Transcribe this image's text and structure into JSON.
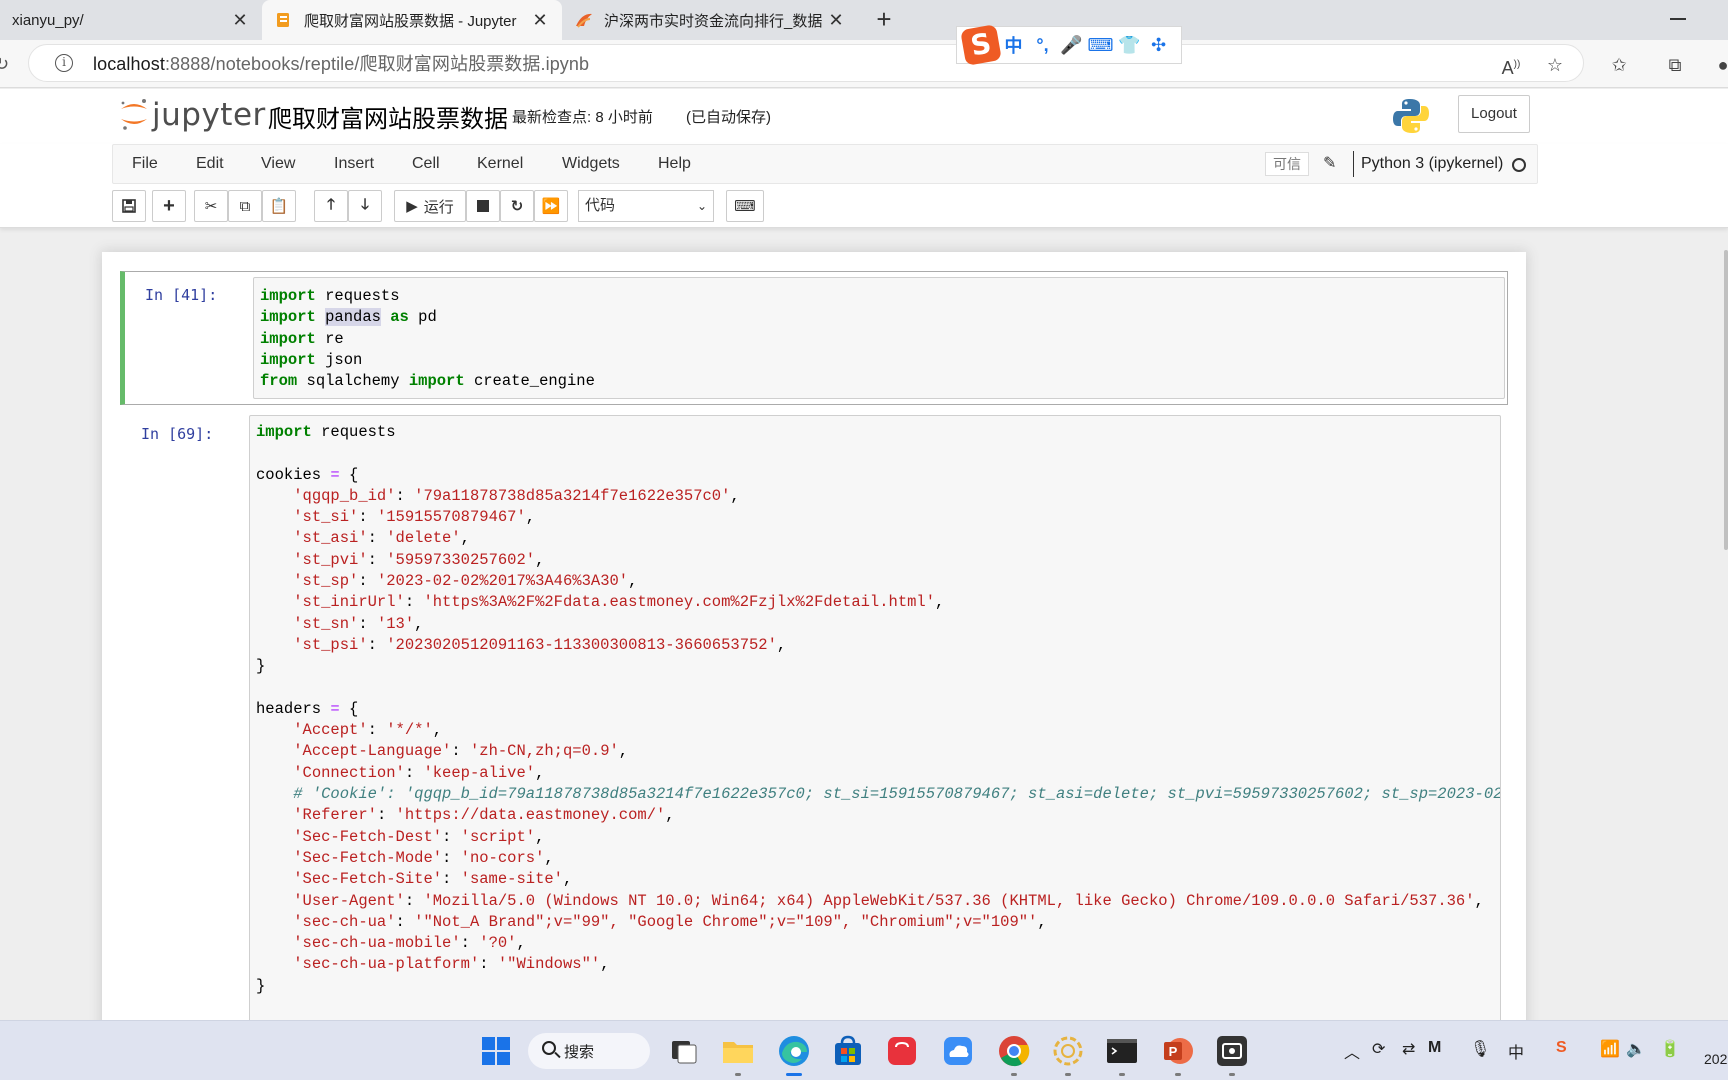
{
  "browser": {
    "tabs": [
      {
        "title": "xianyu_py/"
      },
      {
        "title": "爬取财富网站股票数据 - Jupyter"
      },
      {
        "title": "沪深两市实时资金流向排行_数据"
      }
    ],
    "url_host": "localhost",
    "url_rest": ":8888/notebooks/reptile/爬取财富网站股票数据.ipynb"
  },
  "ime": {
    "items": [
      "中",
      "°,",
      "🎤",
      "⌨",
      "👕",
      "✣"
    ]
  },
  "jupyter": {
    "logo_text": "jupyter",
    "notebook_name": "爬取财富网站股票数据",
    "checkpoint": "最新检查点: 8 小时前",
    "autosave": "(已自动保存)",
    "logout": "Logout",
    "menu": [
      "File",
      "Edit",
      "View",
      "Insert",
      "Cell",
      "Kernel",
      "Widgets",
      "Help"
    ],
    "trusted": "可信",
    "kernel": "Python 3 (ipykernel)",
    "run_label": "运行",
    "cell_type": "代码"
  },
  "cells": [
    {
      "prompt": "In  [41]:"
    },
    {
      "prompt": "In  [69]:"
    }
  ],
  "taskbar": {
    "search": "搜索",
    "year_partial": "202"
  }
}
